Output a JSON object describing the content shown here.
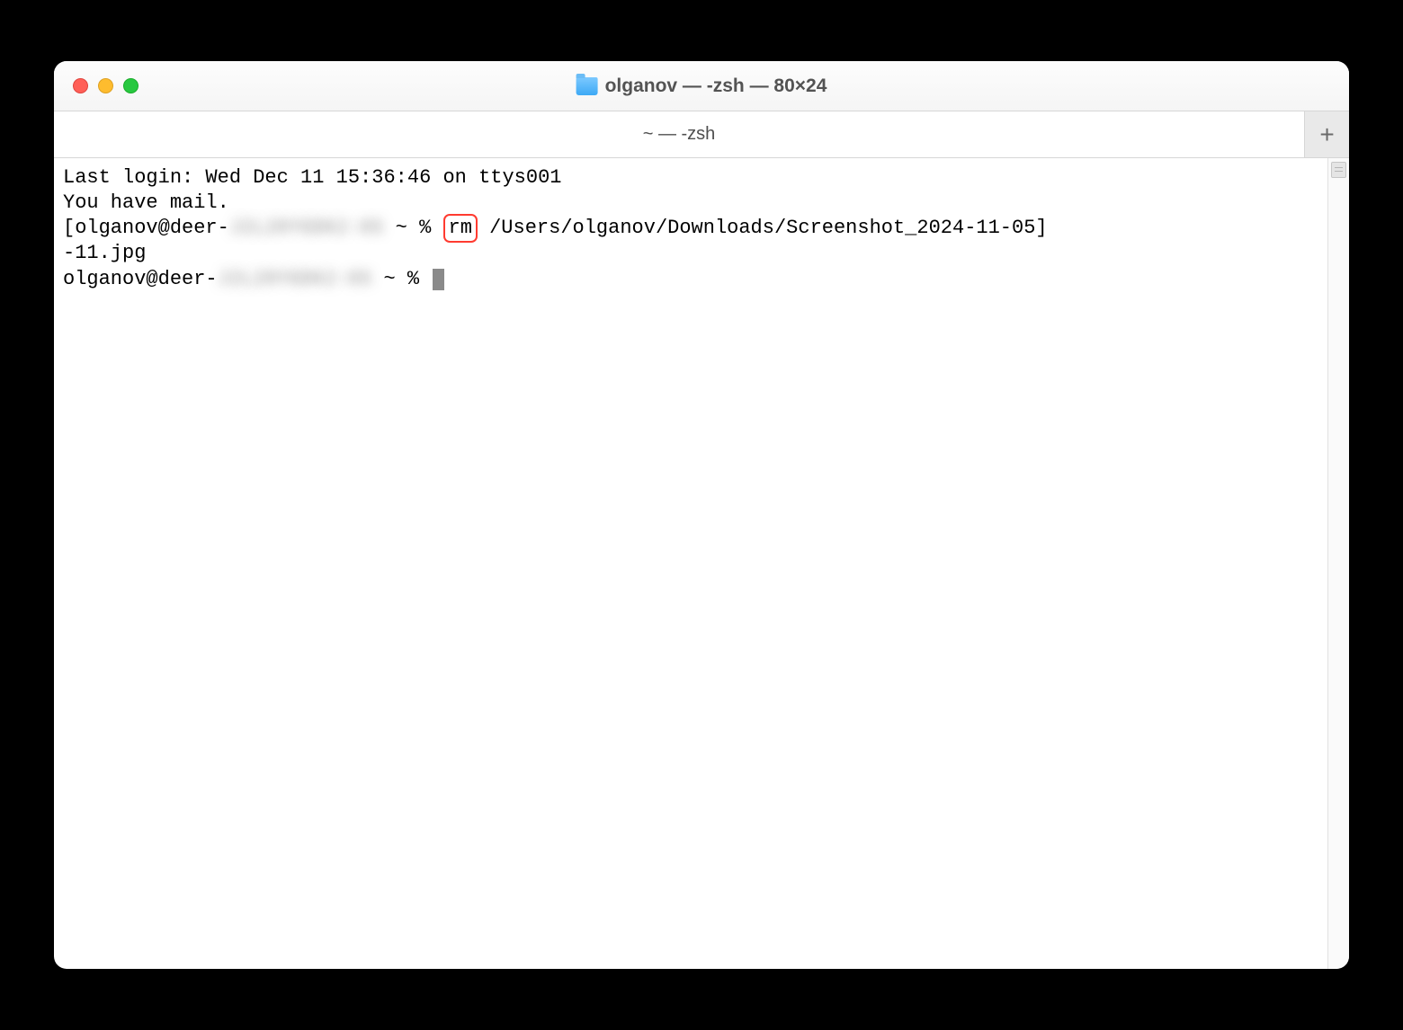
{
  "titlebar": {
    "title": "olganov — -zsh — 80×24"
  },
  "tabbar": {
    "tab_label": "~ — -zsh",
    "new_tab_glyph": "+"
  },
  "terminal": {
    "line1": "Last login: Wed Dec 11 15:36:46 on ttys001",
    "line2": "You have mail.",
    "prompt1_prefix_bracket": "[",
    "prompt1_userhost": "olganov@deer-",
    "prompt1_host_blurred": "J2L20YGDK2-OS",
    "prompt1_path_sym": " ~ % ",
    "command_highlight": "rm",
    "command_rest": " /Users/olganov/Downloads/Screenshot_2024-11-05",
    "prompt1_suffix_bracket": "]",
    "line_wrap": "-11.jpg",
    "prompt2_userhost": "olganov@deer-",
    "prompt2_host_blurred": "J2L20YGDK2-OS",
    "prompt2_path_sym": " ~ % "
  }
}
